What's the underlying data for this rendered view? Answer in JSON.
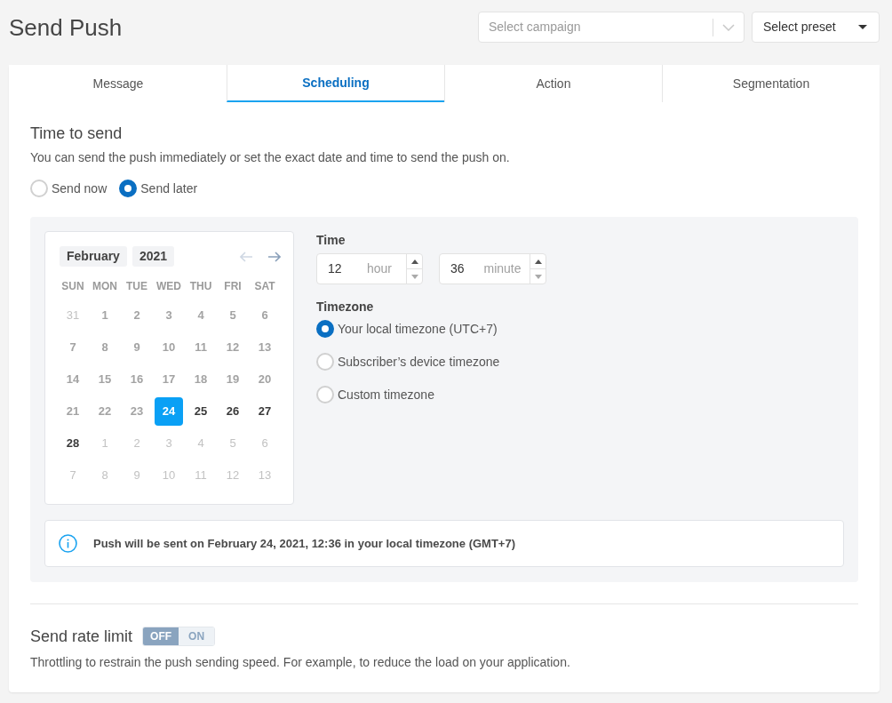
{
  "page": {
    "title": "Send Push"
  },
  "campaign_select": {
    "placeholder": "Select campaign"
  },
  "preset_select": {
    "text": "Select preset"
  },
  "tabs": [
    {
      "label": "Message",
      "selected": false
    },
    {
      "label": "Scheduling",
      "selected": true
    },
    {
      "label": "Action",
      "selected": false
    },
    {
      "label": "Segmentation",
      "selected": false
    }
  ],
  "time_to_send": {
    "title": "Time to send",
    "description": "You can send the push immediately or set the exact date and time to send the push on.",
    "options": [
      {
        "label": "Send now",
        "selected": false
      },
      {
        "label": "Send later",
        "selected": true
      }
    ]
  },
  "calendar": {
    "month": "February",
    "year": "2021",
    "prev_month": {
      "disabled": true
    },
    "next_month": {
      "disabled": false
    },
    "weekdays": [
      "SUN",
      "MON",
      "TUE",
      "WED",
      "THU",
      "FRI",
      "SAT"
    ],
    "days": [
      {
        "text": "31",
        "kind": "outside",
        "selected": false
      },
      {
        "text": "1",
        "kind": "past",
        "selected": false
      },
      {
        "text": "2",
        "kind": "past",
        "selected": false
      },
      {
        "text": "3",
        "kind": "past",
        "selected": false
      },
      {
        "text": "4",
        "kind": "past",
        "selected": false
      },
      {
        "text": "5",
        "kind": "past",
        "selected": false
      },
      {
        "text": "6",
        "kind": "past",
        "selected": false
      },
      {
        "text": "7",
        "kind": "past",
        "selected": false
      },
      {
        "text": "8",
        "kind": "past",
        "selected": false
      },
      {
        "text": "9",
        "kind": "past",
        "selected": false
      },
      {
        "text": "10",
        "kind": "past",
        "selected": false
      },
      {
        "text": "11",
        "kind": "past",
        "selected": false
      },
      {
        "text": "12",
        "kind": "past",
        "selected": false
      },
      {
        "text": "13",
        "kind": "past",
        "selected": false
      },
      {
        "text": "14",
        "kind": "past",
        "selected": false
      },
      {
        "text": "15",
        "kind": "past",
        "selected": false
      },
      {
        "text": "16",
        "kind": "past",
        "selected": false
      },
      {
        "text": "17",
        "kind": "past",
        "selected": false
      },
      {
        "text": "18",
        "kind": "past",
        "selected": false
      },
      {
        "text": "19",
        "kind": "past",
        "selected": false
      },
      {
        "text": "20",
        "kind": "past",
        "selected": false
      },
      {
        "text": "21",
        "kind": "past",
        "selected": false
      },
      {
        "text": "22",
        "kind": "past",
        "selected": false
      },
      {
        "text": "23",
        "kind": "past",
        "selected": false
      },
      {
        "text": "24",
        "kind": "available",
        "selected": true
      },
      {
        "text": "25",
        "kind": "available",
        "selected": false
      },
      {
        "text": "26",
        "kind": "available",
        "selected": false
      },
      {
        "text": "27",
        "kind": "available",
        "selected": false
      },
      {
        "text": "28",
        "kind": "available",
        "selected": false
      },
      {
        "text": "1",
        "kind": "outside",
        "selected": false
      },
      {
        "text": "2",
        "kind": "outside",
        "selected": false
      },
      {
        "text": "3",
        "kind": "outside",
        "selected": false
      },
      {
        "text": "4",
        "kind": "outside",
        "selected": false
      },
      {
        "text": "5",
        "kind": "outside",
        "selected": false
      },
      {
        "text": "6",
        "kind": "outside",
        "selected": false
      },
      {
        "text": "7",
        "kind": "outside",
        "selected": false
      },
      {
        "text": "8",
        "kind": "outside",
        "selected": false
      },
      {
        "text": "9",
        "kind": "outside",
        "selected": false
      },
      {
        "text": "10",
        "kind": "outside",
        "selected": false
      },
      {
        "text": "11",
        "kind": "outside",
        "selected": false
      },
      {
        "text": "12",
        "kind": "outside",
        "selected": false
      },
      {
        "text": "13",
        "kind": "outside",
        "selected": false
      }
    ]
  },
  "time": {
    "label": "Time",
    "fields": [
      {
        "value": "12",
        "unit": "hour"
      },
      {
        "value": "36",
        "unit": "minute"
      }
    ]
  },
  "timezone": {
    "label": "Timezone",
    "options": [
      {
        "label": "Your local timezone (UTC+7)",
        "selected": true
      },
      {
        "label": "Subscriber’s device timezone",
        "selected": false
      },
      {
        "label": "Custom timezone",
        "selected": false
      }
    ]
  },
  "info": {
    "text": "Push will be sent on February 24, 2021, 12:36 in your local timezone (GMT+7)"
  },
  "rate_limit": {
    "title": "Send rate limit",
    "options": [
      {
        "label": "OFF",
        "selected": true
      },
      {
        "label": "ON",
        "selected": false
      }
    ],
    "description": "Throttling to restrain the push sending speed. For example, to reduce the load on your application."
  }
}
